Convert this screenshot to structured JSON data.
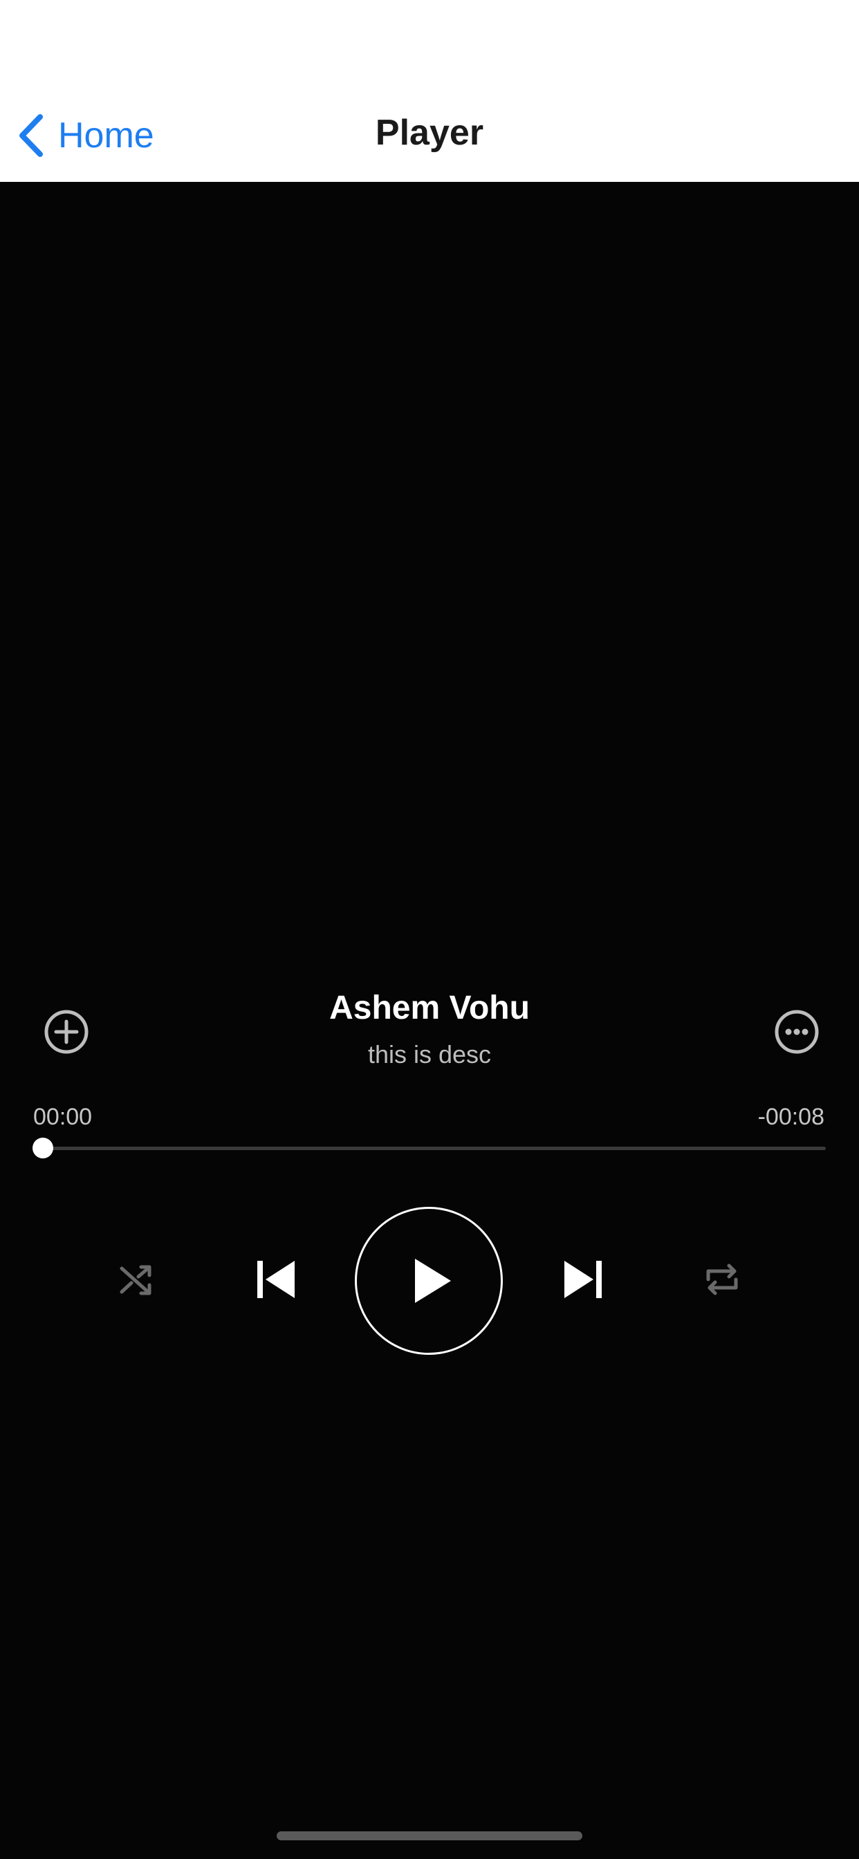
{
  "navbar": {
    "back_label": "Home",
    "title": "Player",
    "accent_color": "#1e7ef0"
  },
  "track": {
    "title": "Ashem Vohu",
    "description": "this is desc"
  },
  "progress": {
    "elapsed": "00:00",
    "remaining": "-00:08",
    "fraction": 0.0
  },
  "controls": {
    "shuffle_icon": "shuffle-icon",
    "previous_icon": "skip-previous-icon",
    "play_icon": "play-icon",
    "next_icon": "skip-next-icon",
    "repeat_icon": "repeat-icon"
  },
  "icons": {
    "add": "plus-circle-icon",
    "more": "ellipsis-circle-icon",
    "back": "chevron-left-icon"
  }
}
